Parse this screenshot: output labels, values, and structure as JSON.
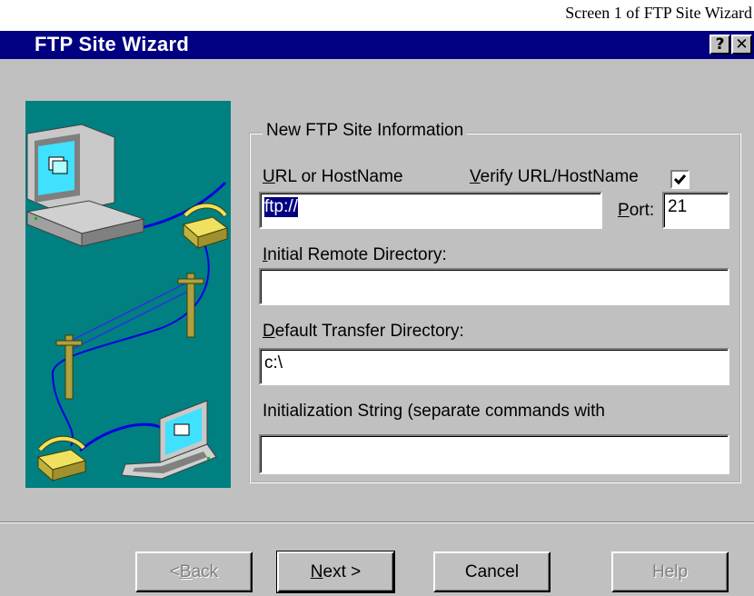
{
  "caption": "Screen 1 of FTP Site Wizard",
  "window": {
    "title": "FTP Site Wizard",
    "help_glyph": "?",
    "close_glyph": "✕"
  },
  "group": {
    "legend": "New FTP Site Information",
    "url_label_first": "U",
    "url_label_rest": "RL or HostName",
    "verify_label_first": "V",
    "verify_label_rest": "erify URL/HostName",
    "verify_checked": true,
    "url_value": "ftp://",
    "port_label_first": "P",
    "port_label_rest": "ort:",
    "port_value": "21",
    "remote_dir_label_first": "I",
    "remote_dir_label_rest": "nitial Remote Directory:",
    "remote_dir_value": "",
    "transfer_dir_label_first": "D",
    "transfer_dir_label_rest": "efault Transfer Directory:",
    "transfer_dir_value": "c:\\",
    "init_string_label": "Initialization String (separate commands with",
    "init_string_value": ""
  },
  "buttons": {
    "back_prefix": "< ",
    "back_first": "B",
    "back_rest": "ack",
    "next_first": "N",
    "next_rest": "ext >",
    "cancel": "Cancel",
    "help": "Help"
  },
  "colors": {
    "dialog_bg": "#c0c0c0",
    "title_bar": "#000080",
    "illustration_bg": "#008080",
    "selection": "#000080"
  },
  "icons": [
    "help-icon",
    "close-icon",
    "computer-icon",
    "telephone-icon",
    "laptop-icon",
    "telephone-pole-icon",
    "checkmark-icon"
  ]
}
